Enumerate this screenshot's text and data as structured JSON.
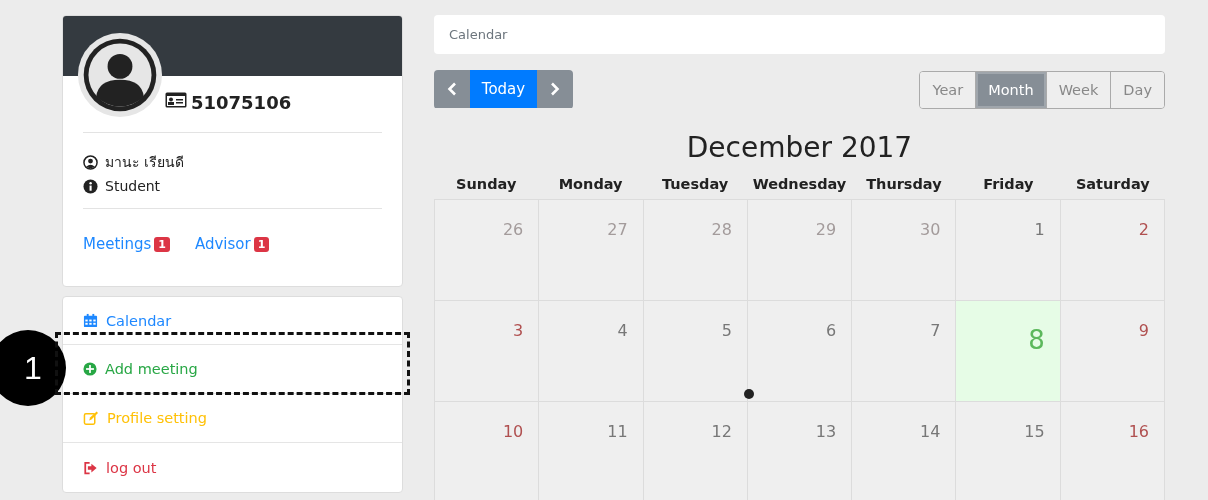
{
  "profile": {
    "student_id": "51075106",
    "name": "มานะ เรียนดี",
    "role": "Student",
    "links": [
      {
        "label": "Meetings",
        "badge": "1"
      },
      {
        "label": "Advisor",
        "badge": "1"
      }
    ]
  },
  "menu": [
    {
      "label": "Calendar",
      "kind": "calendar"
    },
    {
      "label": "Add meeting",
      "kind": "add"
    },
    {
      "label": "Profile setting",
      "kind": "edit"
    },
    {
      "label": "log out",
      "kind": "logout"
    }
  ],
  "annotation": {
    "number": "1"
  },
  "breadcrumb": "Calendar",
  "nav": {
    "today": "Today"
  },
  "views": [
    {
      "label": "Year",
      "selected": false
    },
    {
      "label": "Month",
      "selected": true
    },
    {
      "label": "Week",
      "selected": false
    },
    {
      "label": "Day",
      "selected": false
    }
  ],
  "month_title": "December 2017",
  "weekdays": [
    "Sunday",
    "Monday",
    "Tuesday",
    "Wednesday",
    "Thursday",
    "Friday",
    "Saturday"
  ],
  "weeks": [
    [
      {
        "day": "26",
        "kind": "other",
        "event": false
      },
      {
        "day": "27",
        "kind": "other",
        "event": false
      },
      {
        "day": "28",
        "kind": "other",
        "event": false
      },
      {
        "day": "29",
        "kind": "other",
        "event": false
      },
      {
        "day": "30",
        "kind": "other",
        "event": false
      },
      {
        "day": "1",
        "kind": "normal",
        "event": false
      },
      {
        "day": "2",
        "kind": "weekend",
        "event": false
      }
    ],
    [
      {
        "day": "3",
        "kind": "weekend",
        "event": false
      },
      {
        "day": "4",
        "kind": "normal",
        "event": false
      },
      {
        "day": "5",
        "kind": "normal",
        "event": false
      },
      {
        "day": "6",
        "kind": "normal",
        "event": true
      },
      {
        "day": "7",
        "kind": "normal",
        "event": false
      },
      {
        "day": "8",
        "kind": "today",
        "event": false
      },
      {
        "day": "9",
        "kind": "weekend",
        "event": false
      }
    ],
    [
      {
        "day": "10",
        "kind": "weekend",
        "event": false
      },
      {
        "day": "11",
        "kind": "normal",
        "event": false
      },
      {
        "day": "12",
        "kind": "normal",
        "event": false
      },
      {
        "day": "13",
        "kind": "normal",
        "event": false
      },
      {
        "day": "14",
        "kind": "normal",
        "event": false
      },
      {
        "day": "15",
        "kind": "normal",
        "event": false
      },
      {
        "day": "16",
        "kind": "weekend",
        "event": false
      }
    ]
  ]
}
